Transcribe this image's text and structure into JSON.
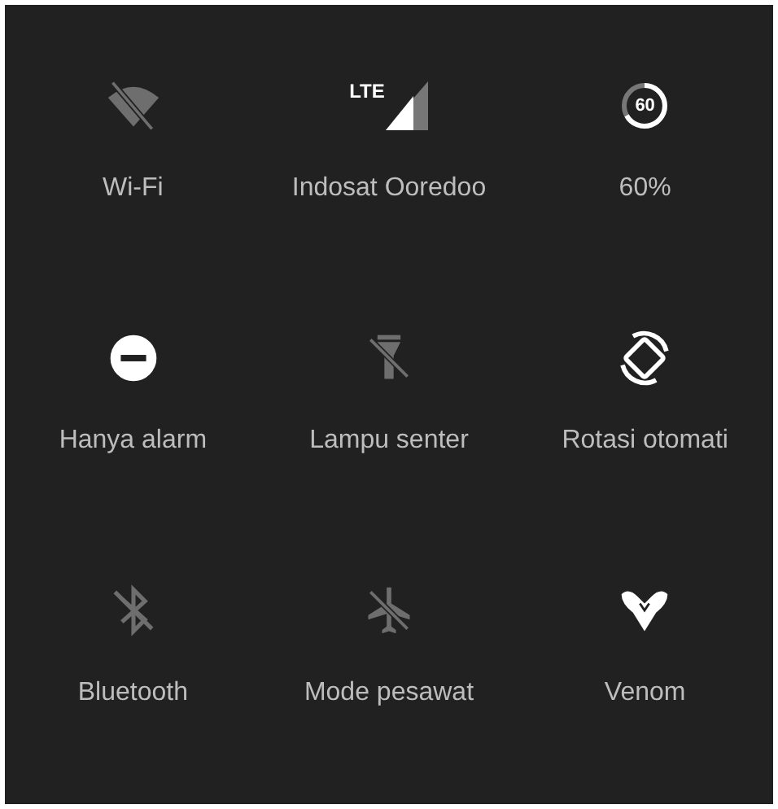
{
  "tiles": [
    {
      "kind": "wifi",
      "label": "Wi-Fi",
      "on": false
    },
    {
      "kind": "cellular",
      "label": "Indosat Ooredoo",
      "on": true,
      "badge": "LTE"
    },
    {
      "kind": "battery",
      "label": "60%",
      "on": true,
      "badge": "60"
    },
    {
      "kind": "dnd",
      "label": "Hanya alarm",
      "on": true
    },
    {
      "kind": "flashlight",
      "label": "Lampu senter",
      "on": false
    },
    {
      "kind": "rotate",
      "label": "Rotasi otomati",
      "on": true
    },
    {
      "kind": "bluetooth",
      "label": "Bluetooth",
      "on": false
    },
    {
      "kind": "airplane",
      "label": "Mode pesawat",
      "on": false
    },
    {
      "kind": "venom",
      "label": "Venom",
      "on": true
    }
  ]
}
